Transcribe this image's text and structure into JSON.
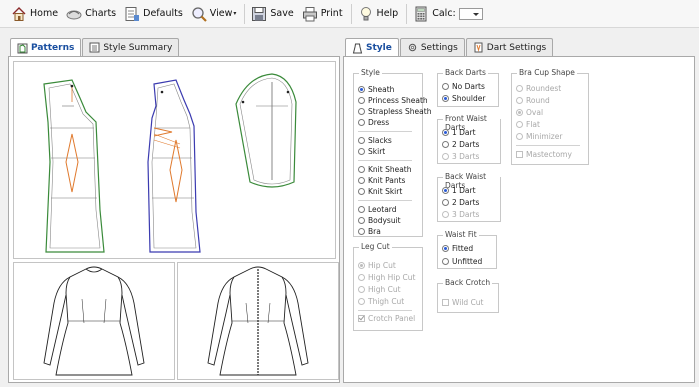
{
  "toolbar": {
    "home": "Home",
    "charts": "Charts",
    "defaults": "Defaults",
    "view": "View",
    "save": "Save",
    "print": "Print",
    "help": "Help",
    "calc": "Calc:",
    "calc_value": ""
  },
  "left_tabs": {
    "patterns": "Patterns",
    "style_summary": "Style Summary"
  },
  "right_tabs": {
    "style": "Style",
    "settings": "Settings",
    "dart_settings": "Dart Settings"
  },
  "style_group": {
    "title": "Style",
    "items": {
      "sheath": "Sheath",
      "princess_sheath": "Princess Sheath",
      "strapless_sheath": "Strapless Sheath",
      "dress": "Dress",
      "slacks": "Slacks",
      "skirt": "Skirt",
      "knit_sheath": "Knit Sheath",
      "knit_pants": "Knit Pants",
      "knit_skirt": "Knit Skirt",
      "leotard": "Leotard",
      "bodysuit": "Bodysuit",
      "bra": "Bra"
    },
    "selected": "Sheath"
  },
  "leg_cut_group": {
    "title": "Leg Cut",
    "items": {
      "hip_cut": "Hip Cut",
      "high_hip_cut": "High Hip Cut",
      "high_cut": "High Cut",
      "thigh_cut": "Thigh Cut"
    },
    "crotch_panel": "Crotch Panel",
    "selected": "Hip Cut",
    "enabled": false
  },
  "back_darts_group": {
    "title": "Back Darts",
    "items": {
      "no_darts": "No Darts",
      "shoulder": "Shoulder"
    },
    "selected": "Shoulder"
  },
  "front_waist_darts_group": {
    "title": "Front Waist Darts",
    "items": {
      "one": "1 Dart",
      "two": "2 Darts",
      "three": "3 Darts"
    },
    "selected": "1 Dart"
  },
  "back_waist_darts_group": {
    "title": "Back Waist Darts",
    "items": {
      "one": "1 Dart",
      "two": "2 Darts",
      "three": "3 Darts"
    },
    "selected": "1 Dart"
  },
  "waist_fit_group": {
    "title": "Waist Fit",
    "items": {
      "fitted": "Fitted",
      "unfitted": "Unfitted"
    },
    "selected": "Fitted"
  },
  "back_crotch_group": {
    "title": "Back Crotch",
    "wild_cut": "Wild Cut",
    "enabled": false
  },
  "bra_cup_group": {
    "title": "Bra Cup Shape",
    "items": {
      "roundest": "Roundest",
      "round": "Round",
      "oval": "Oval",
      "flat": "Flat",
      "minimizer": "Minimizer"
    },
    "mastectomy": "Mastectomy",
    "selected": "Oval",
    "enabled": false
  },
  "colors": {
    "pattern_front": "#3a8a3a",
    "pattern_back": "#3b3bb0",
    "dart_lines": "#e07a2e",
    "accent": "#1a4fa0"
  }
}
